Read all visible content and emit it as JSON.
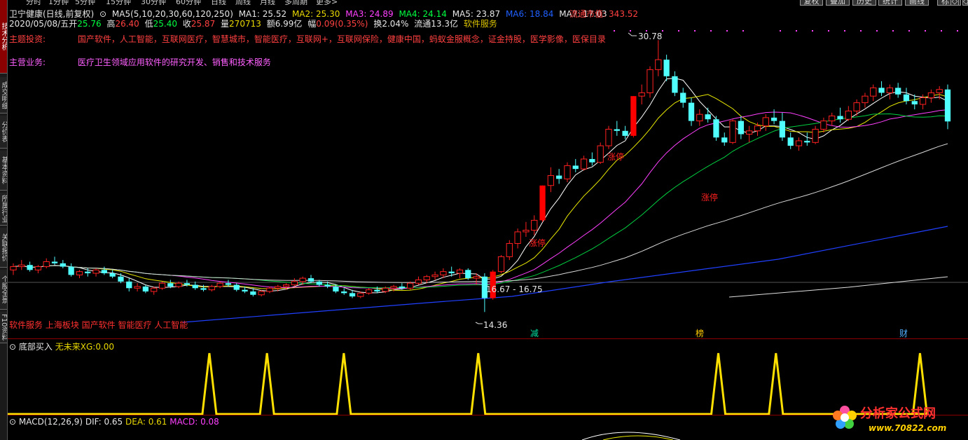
{
  "top_menu": [
    "分时",
    "1分钟",
    "5分钟",
    "15分钟",
    "30分钟",
    "60分钟",
    "日线",
    "周线",
    "月线",
    "多周期",
    "更多>"
  ],
  "top_buttons": [
    "复权",
    "叠加",
    "历史",
    "统计",
    "画线",
    "F10",
    "标记",
    "◇",
    "◇"
  ],
  "side_tabs": [
    "技术分析",
    "成交明细",
    "分价表",
    "基本资料",
    "所属行业",
    "关联报价",
    "个股全景",
    "F10资料"
  ],
  "stock": {
    "name": "卫宁健康(日线,前复权)",
    "ma_params": "MA5(5,10,20,30,60,120,250)",
    "ma1": "MA1: 25.52",
    "ma2": "MA2: 25.30",
    "ma3": "MA3: 24.89",
    "ma4": "MA4: 24.14",
    "ma5": "MA5: 23.87",
    "ma6": "MA6: 18.84",
    "ma7": "MA7: 17.03",
    "float_cap_label": "流通市值:",
    "float_cap_value": "343.52"
  },
  "quote": {
    "date": "2020/05/08/五",
    "open_label": "开",
    "open": "25.76",
    "high_label": "高",
    "high": "26.40",
    "low_label": "低",
    "low": "25.40",
    "close_label": "收",
    "close": "25.87",
    "vol_label": "量",
    "vol": "270713",
    "amt_label": "额",
    "amt": "6.99亿",
    "chg_label": "幅",
    "chg": "0.09(0.35%)",
    "turn_label": "换",
    "turn": "2.04%",
    "flow_label": "流通",
    "flow": "13.3亿",
    "industry": "软件服务"
  },
  "themes": {
    "label": "主题投资:",
    "value": "国产软件，人工智能，互联网医疗，智慧城市，智能医疗，互联网+，互联网保险，健康中国，蚂蚁金服概念，证金持股，医学影像，医保目录"
  },
  "business": {
    "label": "主营业务:",
    "value": "医疗卫生领域应用软件的研究开发、销售和技术服务"
  },
  "annotations": {
    "high_price": "30.78",
    "low_price": "14.36",
    "range": "16.67 - 16.75",
    "limit_up_1": "涨停",
    "limit_up_2": "涨停",
    "limit_up_3": "涨停",
    "tags": "软件服务 上海板块 国产软件 智能医疗 人工智能",
    "event_1": "减",
    "event_2": "榜",
    "event_3": "财"
  },
  "indicator": {
    "name": "底部买入",
    "xg_label": "无未来XG:",
    "xg_value": "0.00"
  },
  "macd": {
    "name": "MACD(12,26,9)",
    "dif": "DIF: 0.65",
    "dea": "DEA: 0.61",
    "macd": "MACD: 0.08"
  },
  "watermark": {
    "site": "分析家公式网",
    "url": "www.70822.com"
  },
  "colors": {
    "up": "#ff2020",
    "down": "#50ffff",
    "ma1": "#ffffff",
    "ma2": "#e8e800",
    "ma3": "#ff40ff",
    "ma4": "#00d040",
    "ma5": "#d8d8d8",
    "ma6": "#2040ff",
    "signal": "#ffe000"
  },
  "chart_data": {
    "type": "candlestick",
    "title": "卫宁健康(日线,前复权)",
    "price_range": [
      14.36,
      30.78
    ],
    "candles": [
      [
        16.9,
        17.3,
        16.6,
        17.1
      ],
      [
        17.1,
        17.5,
        16.9,
        17.2
      ],
      [
        17.2,
        17.4,
        16.8,
        16.9
      ],
      [
        16.9,
        17.2,
        16.7,
        17.1
      ],
      [
        17.1,
        17.6,
        17.0,
        17.4
      ],
      [
        17.4,
        17.7,
        17.2,
        17.3
      ],
      [
        17.3,
        17.5,
        17.0,
        17.1
      ],
      [
        17.1,
        17.3,
        16.5,
        16.6
      ],
      [
        16.6,
        16.9,
        16.4,
        16.8
      ],
      [
        16.8,
        17.0,
        16.5,
        16.7
      ],
      [
        16.7,
        17.0,
        16.5,
        16.9
      ],
      [
        16.9,
        17.1,
        16.6,
        16.7
      ],
      [
        16.7,
        16.9,
        16.4,
        16.5
      ],
      [
        16.5,
        16.7,
        16.1,
        16.2
      ],
      [
        16.2,
        16.4,
        15.6,
        15.8
      ],
      [
        15.8,
        16.1,
        15.6,
        15.9
      ],
      [
        15.9,
        16.0,
        15.5,
        15.6
      ],
      [
        15.6,
        15.9,
        15.4,
        15.8
      ],
      [
        15.8,
        16.2,
        15.7,
        16.1
      ],
      [
        16.1,
        16.3,
        15.8,
        15.9
      ],
      [
        15.9,
        16.2,
        15.8,
        16.1
      ],
      [
        16.1,
        16.3,
        15.9,
        16.0
      ],
      [
        16.0,
        16.2,
        15.7,
        15.8
      ],
      [
        15.8,
        16.0,
        15.6,
        15.7
      ],
      [
        15.7,
        16.0,
        15.6,
        15.9
      ],
      [
        15.9,
        16.2,
        15.8,
        16.1
      ],
      [
        16.1,
        16.3,
        15.9,
        16.0
      ],
      [
        16.0,
        16.1,
        15.6,
        15.7
      ],
      [
        15.7,
        15.9,
        15.5,
        15.6
      ],
      [
        15.6,
        15.8,
        15.3,
        15.4
      ],
      [
        15.4,
        15.7,
        15.3,
        15.6
      ],
      [
        15.6,
        15.9,
        15.5,
        15.8
      ],
      [
        15.8,
        16.0,
        15.6,
        15.9
      ],
      [
        15.9,
        16.1,
        15.7,
        16.0
      ],
      [
        16.0,
        16.4,
        15.9,
        16.2
      ],
      [
        16.2,
        16.5,
        16.0,
        16.4
      ],
      [
        16.4,
        16.6,
        16.1,
        16.2
      ],
      [
        16.2,
        16.3,
        15.9,
        16.0
      ],
      [
        16.0,
        16.2,
        15.8,
        15.9
      ],
      [
        15.9,
        16.0,
        15.5,
        15.6
      ],
      [
        15.6,
        15.8,
        15.4,
        15.5
      ],
      [
        15.5,
        15.7,
        15.2,
        15.3
      ],
      [
        15.3,
        15.6,
        15.2,
        15.5
      ],
      [
        15.5,
        15.8,
        15.4,
        15.7
      ],
      [
        15.7,
        15.9,
        15.5,
        15.6
      ],
      [
        15.6,
        15.9,
        15.5,
        15.8
      ],
      [
        15.8,
        16.0,
        15.6,
        15.9
      ],
      [
        15.9,
        16.1,
        15.7,
        15.8
      ],
      [
        15.8,
        16.2,
        15.7,
        16.1
      ],
      [
        16.1,
        16.5,
        16.0,
        16.3
      ],
      [
        16.3,
        16.6,
        16.1,
        16.5
      ],
      [
        16.5,
        16.8,
        16.3,
        16.6
      ],
      [
        16.6,
        17.0,
        16.4,
        16.8
      ],
      [
        16.8,
        17.1,
        16.5,
        16.7
      ],
      [
        16.7,
        17.0,
        16.4,
        16.9
      ],
      [
        16.9,
        17.0,
        16.3,
        16.4
      ],
      [
        16.4,
        16.7,
        16.0,
        16.5
      ],
      [
        16.5,
        16.7,
        14.36,
        15.2
      ],
      [
        15.2,
        16.9,
        15.1,
        16.8
      ],
      [
        16.8,
        17.8,
        16.7,
        17.7
      ],
      [
        17.7,
        18.7,
        17.5,
        18.5
      ],
      [
        18.5,
        19.4,
        18.2,
        19.2
      ],
      [
        19.2,
        19.8,
        18.9,
        19.3
      ],
      [
        19.3,
        20.2,
        19.0,
        19.9
      ],
      [
        19.9,
        22.0,
        19.8,
        22.0
      ],
      [
        22.0,
        23.1,
        21.6,
        22.6
      ],
      [
        22.6,
        23.0,
        22.1,
        22.4
      ],
      [
        22.4,
        23.4,
        22.2,
        23.2
      ],
      [
        23.2,
        23.6,
        22.8,
        23.0
      ],
      [
        23.0,
        23.8,
        22.9,
        23.6
      ],
      [
        23.6,
        24.0,
        23.2,
        23.4
      ],
      [
        23.4,
        24.6,
        23.3,
        24.4
      ],
      [
        24.4,
        25.6,
        24.2,
        25.4
      ],
      [
        25.4,
        25.9,
        25.0,
        25.3
      ],
      [
        25.3,
        25.6,
        24.8,
        25.0
      ],
      [
        25.0,
        27.4,
        24.9,
        27.4
      ],
      [
        27.4,
        28.1,
        26.9,
        27.6
      ],
      [
        27.6,
        29.2,
        27.3,
        29.0
      ],
      [
        29.0,
        30.78,
        28.6,
        29.6
      ],
      [
        29.6,
        29.9,
        28.3,
        28.6
      ],
      [
        28.6,
        28.9,
        27.4,
        27.6
      ],
      [
        27.6,
        27.9,
        26.7,
        27.0
      ],
      [
        27.0,
        27.3,
        25.6,
        25.9
      ],
      [
        25.9,
        26.6,
        25.6,
        26.3
      ],
      [
        26.3,
        26.7,
        25.8,
        26.0
      ],
      [
        26.0,
        26.2,
        24.7,
        24.9
      ],
      [
        24.9,
        25.2,
        24.4,
        24.6
      ],
      [
        24.6,
        26.0,
        24.5,
        25.9
      ],
      [
        25.9,
        26.2,
        24.8,
        25.1
      ],
      [
        25.1,
        25.6,
        24.6,
        25.3
      ],
      [
        25.3,
        25.8,
        25.0,
        25.6
      ],
      [
        25.6,
        26.3,
        25.3,
        26.1
      ],
      [
        26.1,
        26.6,
        25.7,
        25.9
      ],
      [
        25.9,
        26.4,
        24.7,
        24.9
      ],
      [
        24.9,
        25.2,
        24.2,
        24.4
      ],
      [
        24.4,
        24.9,
        24.1,
        24.7
      ],
      [
        24.7,
        25.2,
        24.4,
        24.6
      ],
      [
        24.6,
        25.6,
        24.5,
        25.4
      ],
      [
        25.4,
        26.1,
        25.2,
        25.9
      ],
      [
        25.9,
        26.4,
        25.6,
        26.2
      ],
      [
        26.2,
        26.7,
        25.8,
        26.0
      ],
      [
        26.0,
        26.8,
        25.9,
        26.5
      ],
      [
        26.5,
        27.2,
        26.2,
        27.0
      ],
      [
        27.0,
        27.6,
        26.7,
        27.4
      ],
      [
        27.4,
        28.1,
        27.1,
        27.9
      ],
      [
        27.9,
        28.3,
        27.4,
        27.6
      ],
      [
        27.6,
        28.1,
        27.2,
        27.9
      ],
      [
        27.9,
        28.2,
        27.3,
        27.5
      ],
      [
        27.5,
        27.9,
        26.9,
        27.1
      ],
      [
        27.1,
        27.5,
        26.6,
        26.9
      ],
      [
        26.9,
        27.5,
        26.6,
        27.3
      ],
      [
        27.3,
        27.8,
        27.0,
        27.6
      ],
      [
        27.6,
        28.0,
        27.2,
        27.8
      ],
      [
        27.8,
        28.1,
        25.4,
        25.87
      ]
    ],
    "signal_peaks": [
      0.21,
      0.27,
      0.35,
      0.49,
      0.74,
      0.8,
      0.95
    ]
  }
}
